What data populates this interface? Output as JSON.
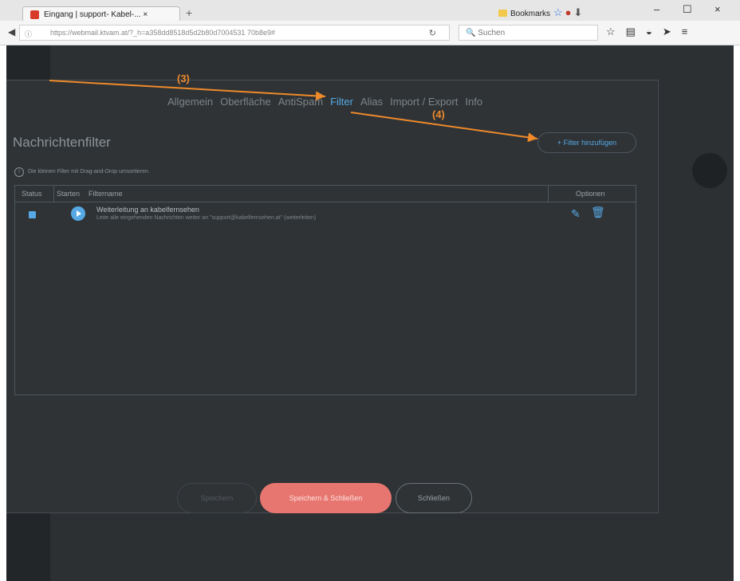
{
  "browser": {
    "tab_title": "Eingang | support- Kabel-... ×",
    "tab_close": "×",
    "new_tab": "+",
    "bookmarks_label": "Bookmarks",
    "url": "https://webmail.ktvam.at/?_h=a358dd8518d5d2b80d7004531 70b8e9#",
    "search_placeholder": "Suchen",
    "window_buttons": [
      "–",
      "☐",
      "×"
    ]
  },
  "settings_tabs": [
    "Allgemein",
    "Oberfläche",
    "AntiSpam",
    "Filter",
    "Alias",
    "Import / Export",
    "Info"
  ],
  "active_tab": "Filter",
  "annotations": [
    "(3)",
    "(4)"
  ],
  "page": {
    "title": "Nachrichtenfilter",
    "add_button": "+ Filter hinzufügen",
    "info_text": "Die kleinen Filter mit Drag-and-Drop umsortieren."
  },
  "table": {
    "headers": [
      "Status",
      "Starten",
      "Filtername",
      "Optionen"
    ],
    "rows": [
      {
        "name": "Weiterleitung an kabelfernsehen",
        "description": "Leite alle eingehenden Nachrichten weiter an \"support@kabelfernsehen.at\" (weiterleiten)",
        "enabled": true
      }
    ]
  },
  "buttons": {
    "disabled": "Speichern",
    "save_close": "Speichern & Schließen",
    "close": "Schließen"
  },
  "colors": {
    "accent": "#56a9e4",
    "save": "#e87670",
    "annotation": "#ee8a2a",
    "background": "#2c3033"
  }
}
